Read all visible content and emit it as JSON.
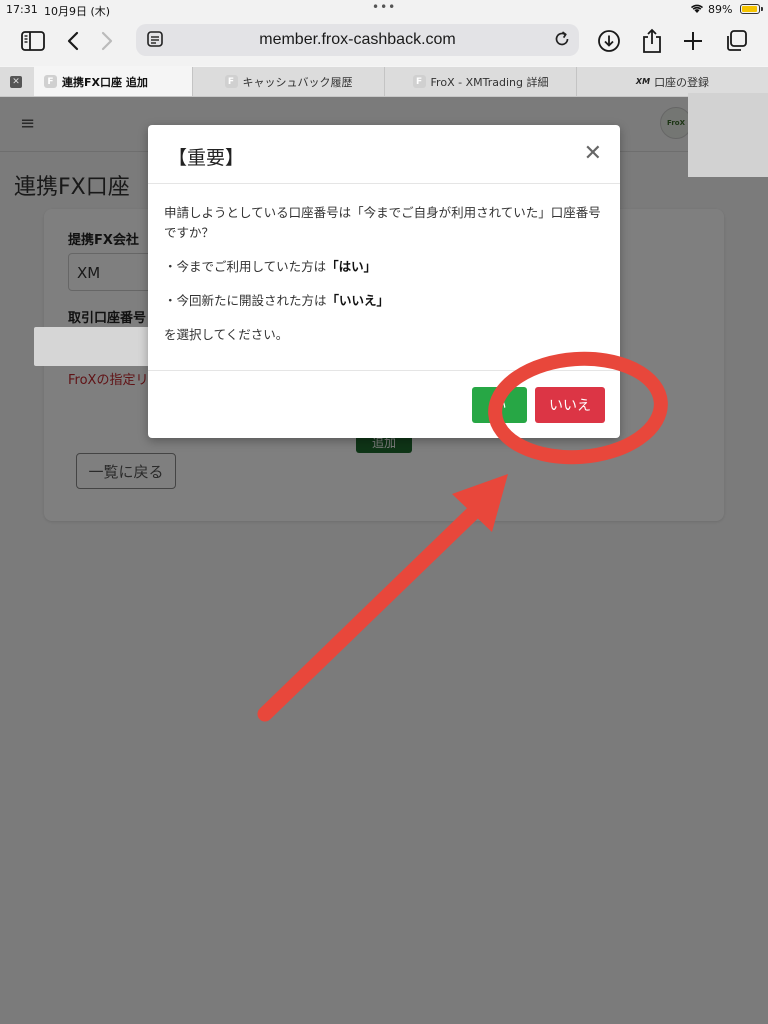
{
  "status_bar": {
    "time": "17:31",
    "date": "10月9日 (木)",
    "battery": "89%"
  },
  "browser": {
    "url": "member.frox-cashback.com",
    "tabs": [
      {
        "label": "連携FX口座 追加",
        "favicon": "F",
        "active": true
      },
      {
        "label": "キャッシュバック履歴",
        "favicon": "F",
        "active": false
      },
      {
        "label": "FroX - XMTrading 詳細",
        "favicon": "F",
        "active": false
      },
      {
        "label": "口座の登録",
        "favicon": "XM",
        "active": false
      }
    ]
  },
  "page": {
    "title": "連携FX口座",
    "logo_text": "FroX",
    "broker_label": "提携FX会社",
    "broker_value": "XM",
    "account_label": "取引口座番号",
    "note": "FroXの指定リ",
    "add_button": "追加",
    "back_button": "一覧に戻る"
  },
  "modal": {
    "title": "【重要】",
    "question": "申請しようとしている口座番号は「今までご自身が利用されていた」口座番号ですか？",
    "line1_prefix": "・今までご利用していた方は",
    "line1_bold": "「はい」",
    "line2_prefix": "・今回新たに開設された方は",
    "line2_bold": "「いいえ」",
    "instruction": "を選択してください。",
    "yes_label": "い",
    "no_label": "いいえ"
  },
  "colors": {
    "yes": "#27a745",
    "no": "#dc3545",
    "annotation": "#e8473b"
  }
}
